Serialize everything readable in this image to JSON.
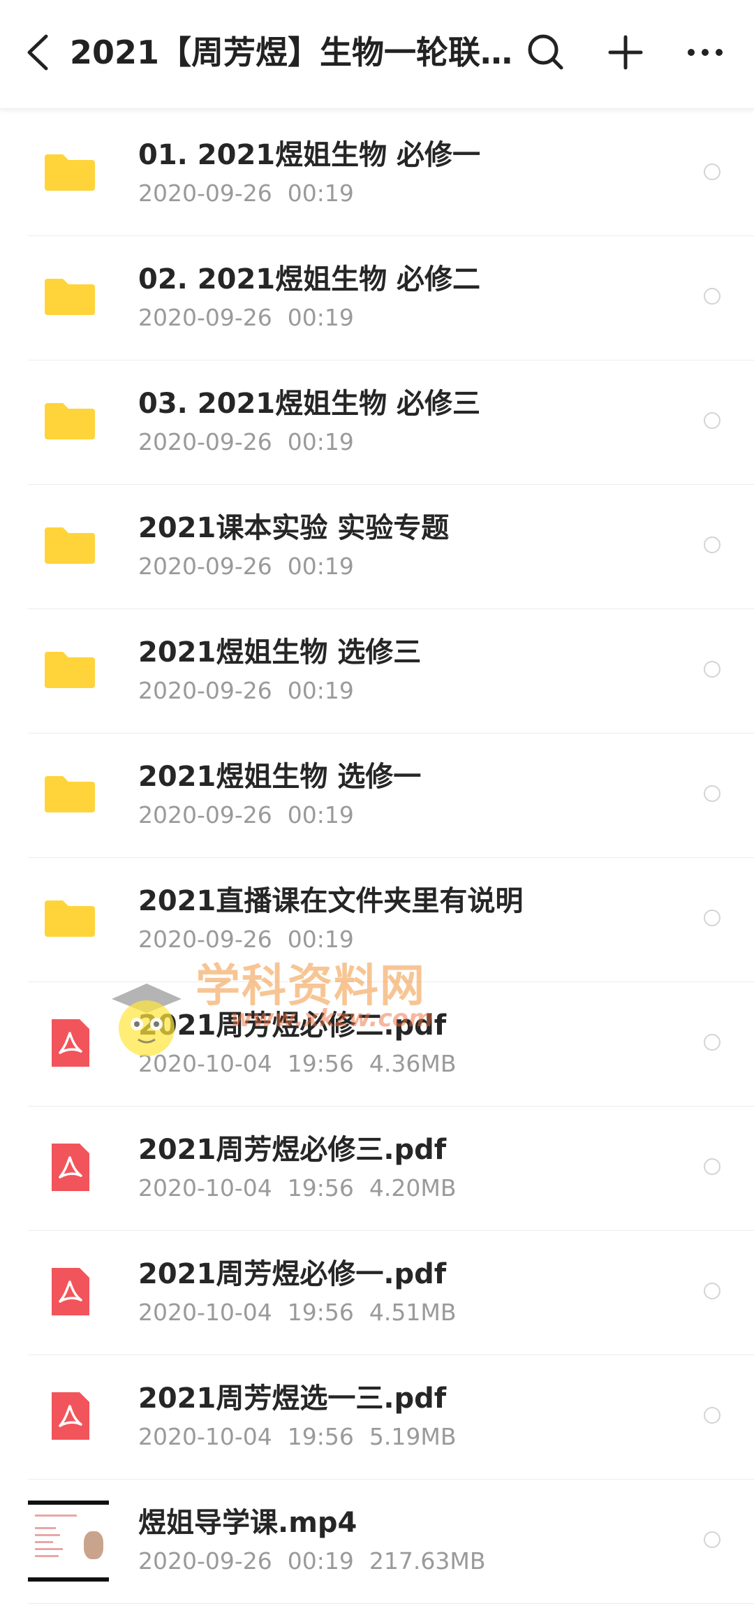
{
  "header": {
    "title": "2021【周芳煜】生物一轮联...",
    "back_icon": "chevron-left-icon",
    "search_icon": "search-icon",
    "add_icon": "plus-icon",
    "more_icon": "more-horizontal-icon"
  },
  "colors": {
    "folder": "#FFD43A",
    "pdf": "#F2545B",
    "meta_text": "#9a9a9a",
    "separator": "#ececec"
  },
  "files": [
    {
      "type": "folder",
      "name": "01. 2021煜姐生物 必修一",
      "date": "2020-09-26",
      "time": "00:19",
      "size": ""
    },
    {
      "type": "folder",
      "name": "02. 2021煜姐生物 必修二",
      "date": "2020-09-26",
      "time": "00:19",
      "size": ""
    },
    {
      "type": "folder",
      "name": "03. 2021煜姐生物 必修三",
      "date": "2020-09-26",
      "time": "00:19",
      "size": ""
    },
    {
      "type": "folder",
      "name": "2021课本实验 实验专题",
      "date": "2020-09-26",
      "time": "00:19",
      "size": ""
    },
    {
      "type": "folder",
      "name": "2021煜姐生物 选修三",
      "date": "2020-09-26",
      "time": "00:19",
      "size": ""
    },
    {
      "type": "folder",
      "name": "2021煜姐生物 选修一",
      "date": "2020-09-26",
      "time": "00:19",
      "size": ""
    },
    {
      "type": "folder",
      "name": "2021直播课在文件夹里有说明",
      "date": "2020-09-26",
      "time": "00:19",
      "size": ""
    },
    {
      "type": "pdf",
      "name": "2021周芳煜必修二.pdf",
      "date": "2020-10-04",
      "time": "19:56",
      "size": "4.36MB"
    },
    {
      "type": "pdf",
      "name": "2021周芳煜必修三.pdf",
      "date": "2020-10-04",
      "time": "19:56",
      "size": "4.20MB"
    },
    {
      "type": "pdf",
      "name": "2021周芳煜必修一.pdf",
      "date": "2020-10-04",
      "time": "19:56",
      "size": "4.51MB"
    },
    {
      "type": "pdf",
      "name": "2021周芳煜选一三.pdf",
      "date": "2020-10-04",
      "time": "19:56",
      "size": "5.19MB"
    },
    {
      "type": "video",
      "name": "煜姐导学课.mp4",
      "date": "2020-09-26",
      "time": "00:19",
      "size": "217.63MB"
    }
  ],
  "watermark": {
    "text": "学科资料网",
    "url": "www.xkzw.com"
  }
}
